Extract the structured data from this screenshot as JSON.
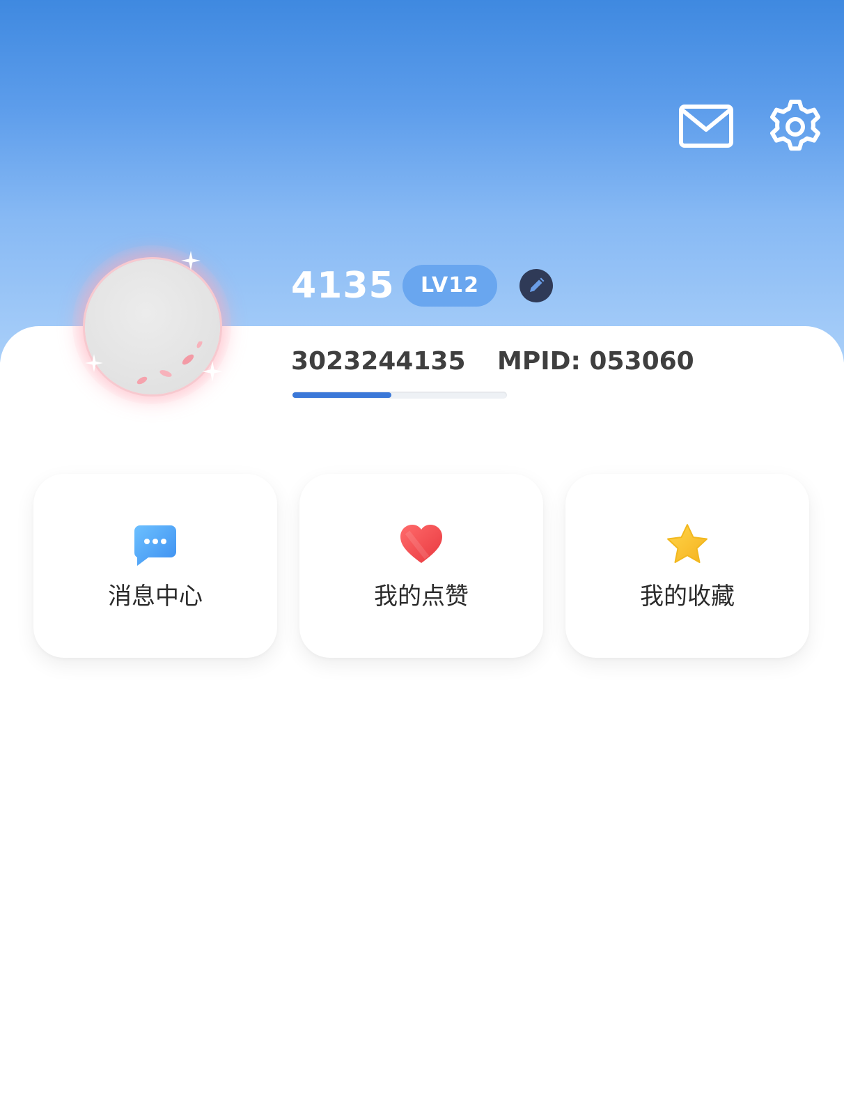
{
  "header": {
    "icons": {
      "mail": "mail-icon",
      "settings": "gear-icon"
    },
    "colors": {
      "gradient_top": "#3f89e0",
      "gradient_bottom": "#a9cff9"
    }
  },
  "profile": {
    "username": "4135",
    "level": "LV12",
    "user_id": "3023244135",
    "mpid": "MPID: 053060",
    "exp_progress_fraction": 0.46,
    "colors": {
      "level_badge": "#69a6ef",
      "edit_button": "#2f3a57",
      "progress": "#3b78d8"
    }
  },
  "quick_actions": [
    {
      "label": "消息中心",
      "icon": "chat-bubble-icon",
      "color": "#4aa3f5"
    },
    {
      "label": "我的点赞",
      "icon": "heart-icon",
      "color": "#f2484e"
    },
    {
      "label": "我的收藏",
      "icon": "star-icon",
      "color": "#f7c432"
    }
  ]
}
